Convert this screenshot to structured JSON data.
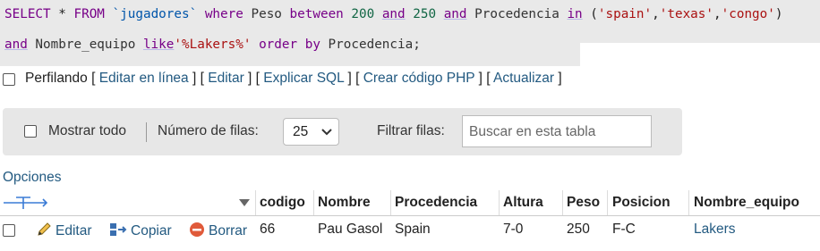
{
  "sql": {
    "line1": [
      {
        "t": "SELECT",
        "c": "kwp"
      },
      {
        "t": " * ",
        "c": "op"
      },
      {
        "t": "FROM",
        "c": "kwp"
      },
      {
        "t": " ",
        "c": "op"
      },
      {
        "t": "`jugadores`",
        "c": "tbl"
      },
      {
        "t": " where ",
        "c": "kwp"
      },
      {
        "t": "Peso",
        "c": "fn"
      },
      {
        "t": " between ",
        "c": "kwp"
      },
      {
        "t": "200",
        "c": "num"
      },
      {
        "t": " ",
        "c": "op"
      },
      {
        "t": "and",
        "c": "kw"
      },
      {
        "t": " ",
        "c": "op"
      },
      {
        "t": "250",
        "c": "num"
      },
      {
        "t": " ",
        "c": "op"
      },
      {
        "t": "and",
        "c": "kw"
      },
      {
        "t": " Procedencia ",
        "c": "fn"
      },
      {
        "t": "in",
        "c": "kw"
      },
      {
        "t": " (",
        "c": "op"
      },
      {
        "t": "'spain'",
        "c": "str"
      },
      {
        "t": ",",
        "c": "op"
      },
      {
        "t": "'texas'",
        "c": "str"
      },
      {
        "t": ",",
        "c": "op"
      },
      {
        "t": "'congo'",
        "c": "str"
      },
      {
        "t": ")",
        "c": "op"
      }
    ],
    "line2": [
      {
        "t": "and",
        "c": "kw"
      },
      {
        "t": " Nombre_equipo ",
        "c": "fn"
      },
      {
        "t": "like",
        "c": "kw"
      },
      {
        "t": "'%Lakers%'",
        "c": "str"
      },
      {
        "t": " order by ",
        "c": "kwp"
      },
      {
        "t": "Procedencia;",
        "c": "fn"
      }
    ]
  },
  "links": {
    "profiling": "Perfilando",
    "edit_inline": "Editar en línea",
    "edit": "Editar",
    "explain": "Explicar SQL",
    "php": "Crear código PHP",
    "refresh": "Actualizar"
  },
  "toolbar": {
    "show_all": "Mostrar todo",
    "rows_label": "Número de filas:",
    "rows_value": "25",
    "filter_label": "Filtrar filas:",
    "search_placeholder": "Buscar en esta tabla"
  },
  "options_label": "Opciones",
  "table": {
    "columns": [
      "codigo",
      "Nombre",
      "Procedencia",
      "Altura",
      "Peso",
      "Posicion",
      "Nombre_equipo"
    ],
    "rows": [
      {
        "actions": {
          "edit": "Editar",
          "copy": "Copiar",
          "delete": "Borrar"
        },
        "codigo": "66",
        "nombre": "Pau Gasol",
        "procedencia": "Spain",
        "altura": "7-0",
        "peso": "250",
        "posicion": "F-C",
        "equipo": "Lakers"
      }
    ]
  }
}
